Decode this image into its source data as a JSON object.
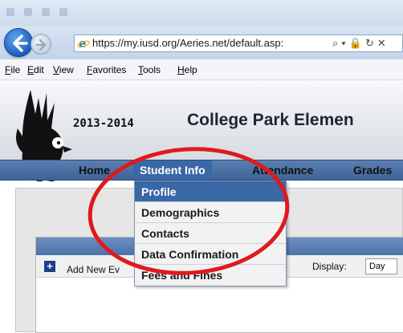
{
  "browser": {
    "url": "https://my.iusd.org/Aeries.net/default.asp:",
    "menu": [
      "File",
      "Edit",
      "View",
      "Favorites",
      "Tools",
      "Help"
    ]
  },
  "header": {
    "school_year": "2013-2014",
    "school_name": "College Park Elemen"
  },
  "nav": {
    "items": [
      "Home",
      "Student Info",
      "Attendance",
      "Grades"
    ],
    "active": "Student Info"
  },
  "student_info_menu": {
    "items": [
      "Profile",
      "Demographics",
      "Contacts",
      "Data Confirmation",
      "Fees and Fines"
    ],
    "highlighted": "Profile"
  },
  "content": {
    "add_new_label": "Add New Ev",
    "display_label": "Display:",
    "display_value": "Day"
  },
  "colors": {
    "nav_bar": "#4a6fa5",
    "menu_highlight": "#3a67a6",
    "annotation_circle": "#e0191c"
  },
  "icons": [
    "back-arrow-icon",
    "forward-arrow-icon",
    "ie-logo-icon",
    "search-icon",
    "lock-icon",
    "refresh-icon",
    "close-icon",
    "eagle-logo",
    "add-icon"
  ]
}
